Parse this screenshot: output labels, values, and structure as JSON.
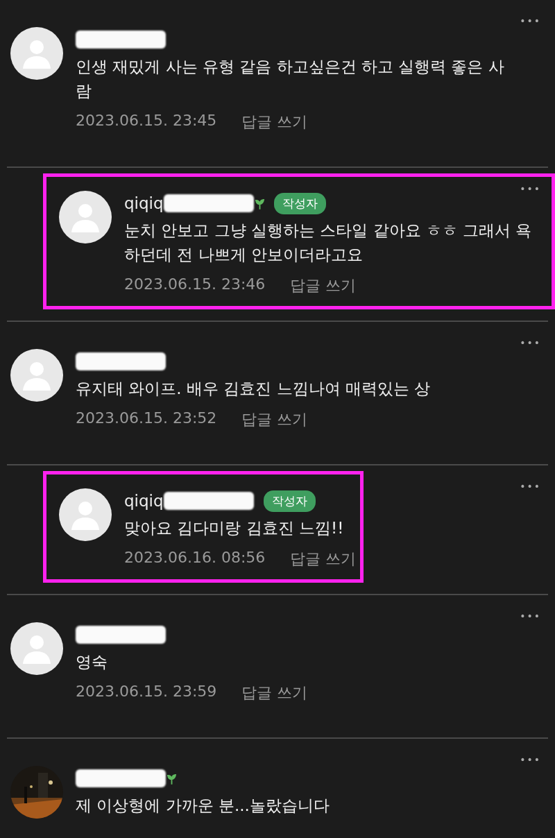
{
  "comments": [
    {
      "reply": false,
      "highlighted": false,
      "redacted": true,
      "sprout": false,
      "avatar": {
        "kind": "default"
      },
      "text": "인생 재밌게 사는 유형 같음 하고싶은건 하고 실행력 좋은 사람",
      "date": "2023.06.15. 23:45",
      "reply_link": "답글 쓰기",
      "more": "•••"
    },
    {
      "reply": true,
      "highlighted": true,
      "name": "qiqiq",
      "redacted": true,
      "sprout": true,
      "author_badge": "작성자",
      "avatar": {
        "kind": "default"
      },
      "text": "눈치 안보고 그냥 실행하는 스타일 같아요 ㅎㅎ 그래서 욕하던데 전 나쁘게 안보이더라고요",
      "date": "2023.06.15. 23:46",
      "reply_link": "답글 쓰기",
      "more": "•••"
    },
    {
      "reply": false,
      "highlighted": false,
      "redacted": true,
      "sprout": false,
      "avatar": {
        "kind": "default"
      },
      "text": "유지태 와이프. 배우 김효진 느낌나여 매력있는 상",
      "date": "2023.06.15. 23:52",
      "reply_link": "답글 쓰기",
      "more": "•••"
    },
    {
      "reply": true,
      "highlighted": true,
      "name": "qiqiq",
      "redacted": true,
      "sprout": false,
      "author_badge": "작성자",
      "avatar": {
        "kind": "default"
      },
      "text": "맞아요 김다미랑 김효진 느낌!!",
      "date": "2023.06.16. 08:56",
      "reply_link": "답글 쓰기",
      "more": "•••"
    },
    {
      "reply": false,
      "highlighted": false,
      "redacted": true,
      "sprout": false,
      "avatar": {
        "kind": "default"
      },
      "text": "영숙",
      "date": "2023.06.15. 23:59",
      "reply_link": "답글 쓰기",
      "more": "•••"
    },
    {
      "reply": false,
      "highlighted": false,
      "redacted": true,
      "sprout": true,
      "text": "제 이상형에 가까운 분...놀랐습니다",
      "more": "•••"
    }
  ]
}
